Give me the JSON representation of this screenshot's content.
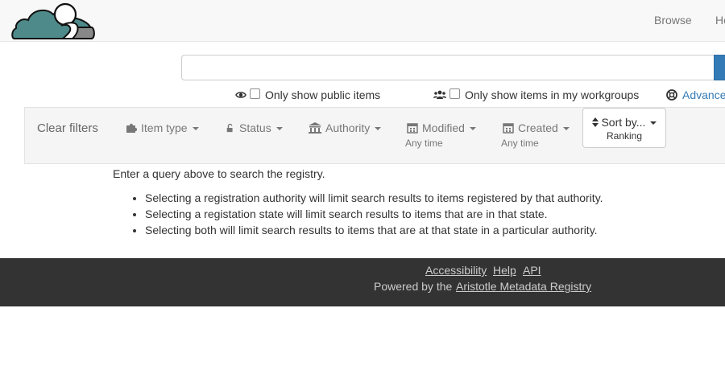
{
  "nav": {
    "links": [
      "Browse",
      "He"
    ]
  },
  "search": {
    "value": "",
    "placeholder": ""
  },
  "options": {
    "public_only": "Only show public items",
    "workgroups_only": "Only show items in my workgroups",
    "advanced": "Advance"
  },
  "filters": {
    "clear": "Clear filters",
    "item_type": "Item type",
    "status": "Status",
    "authority": "Authority",
    "modified": "Modified",
    "modified_sub": "Any time",
    "created": "Created",
    "created_sub": "Any time",
    "sort_label": "Sort by...",
    "sort_value": "Ranking"
  },
  "content": {
    "intro": "Enter a query above to search the registry.",
    "hints": [
      "Selecting a registration authority will limit search results to items registered by that authority.",
      "Selecting a registation state will limit search results to items that are in that state.",
      "Selecting both will limit search results to items that are at that state in a particular authority."
    ]
  },
  "footer": {
    "links": [
      "Accessibility",
      "Help",
      "API"
    ],
    "powered_by": "Powered by the",
    "registry_link": "Aristotle Metadata Registry"
  },
  "colors": {
    "brand_teal": "#4f8a8b",
    "primary": "#337ab7",
    "footer_bg": "#333333"
  }
}
